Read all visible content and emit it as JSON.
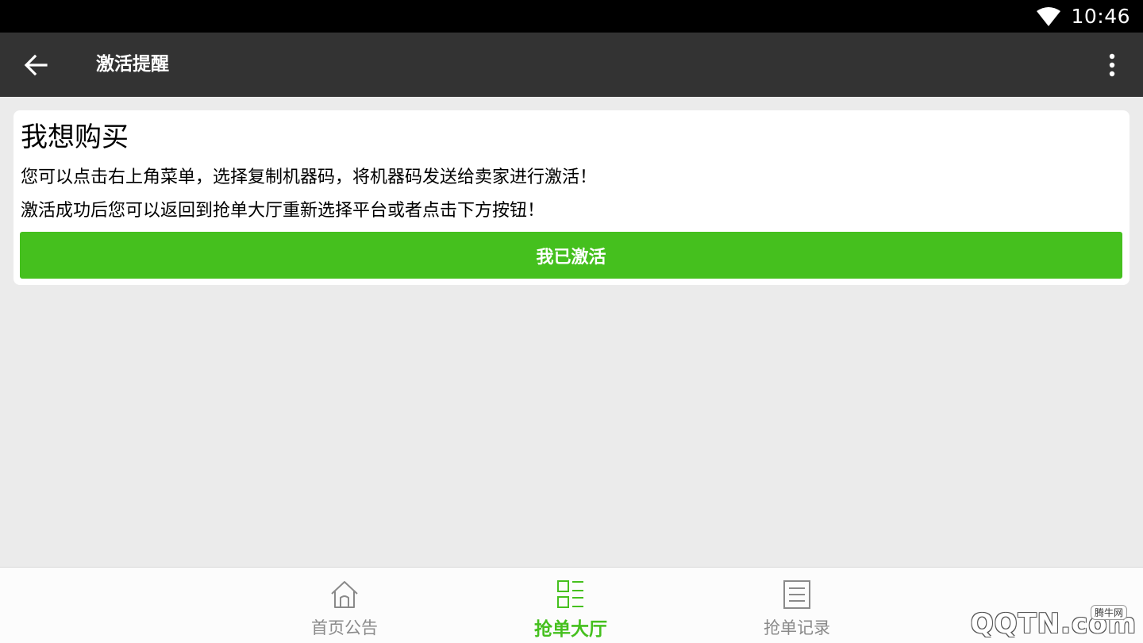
{
  "status_bar": {
    "time": "10:46",
    "wifi_icon": "wifi-icon"
  },
  "app_bar": {
    "back_icon": "arrow-left-icon",
    "title": "激活提醒",
    "more_icon": "more-vertical-icon"
  },
  "card": {
    "heading": "我想购买",
    "line1": "您可以点击右上角菜单，选择复制机器码，将机器码发送给卖家进行激活！",
    "line2": "激活成功后您可以返回到抢单大厅重新选择平台或者点击下方按钮！",
    "button_label": "我已激活"
  },
  "bottom_nav": {
    "items": [
      {
        "label": "首页公告",
        "icon": "home-icon",
        "active": false
      },
      {
        "label": "抢单大厅",
        "icon": "grid-list-icon",
        "active": true
      },
      {
        "label": "抢单记录",
        "icon": "document-list-icon",
        "active": false
      }
    ]
  },
  "watermark": {
    "small": "腾牛网",
    "big": "QQTN.com"
  },
  "colors": {
    "accent": "#45c01e",
    "app_bar": "#333333",
    "status_bar": "#000000",
    "background": "#ebebeb",
    "inactive_nav": "#8a8a8a"
  }
}
